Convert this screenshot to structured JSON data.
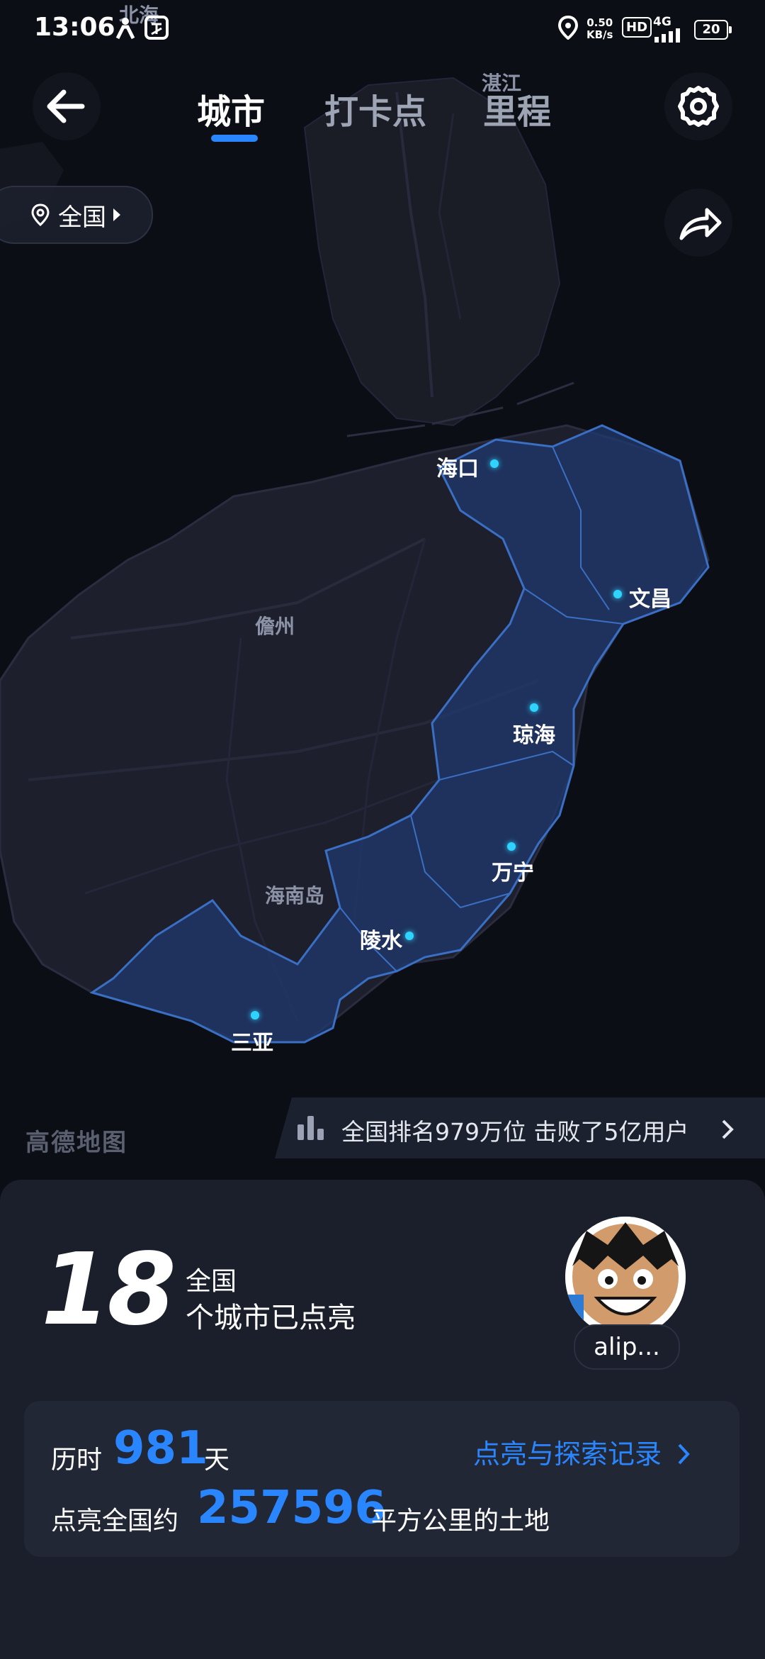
{
  "status_bar": {
    "time": "13:06",
    "net_speed_value": "0.50",
    "net_speed_unit": "KB/s",
    "hd_label": "HD",
    "signal_label": "4G",
    "battery_level": "20",
    "icons": [
      "person-icon",
      "app-badge-icon",
      "location-icon",
      "hd-icon",
      "signal-icon",
      "battery-icon"
    ]
  },
  "nav": {
    "tabs": [
      {
        "label": "城市",
        "active": true
      },
      {
        "label": "打卡点",
        "active": false
      },
      {
        "label": "里程",
        "active": false
      }
    ],
    "back_icon": "arrow-left-icon",
    "settings_icon": "gear-icon",
    "share_icon": "share-icon"
  },
  "region_selector": {
    "label": "全国"
  },
  "map": {
    "geo_labels": [
      "北海",
      "湛江",
      "儋州",
      "海南岛"
    ],
    "cities": [
      "海口",
      "文昌",
      "琼海",
      "万宁",
      "陵水",
      "三亚"
    ],
    "highlight_color": "#1f3a6e",
    "dot_color": "#2fd3ff",
    "logo": "高德地图"
  },
  "rank_banner": {
    "text": "全国排名979万位 击败了5亿用户"
  },
  "summary": {
    "city_count": "18",
    "scope": "全国",
    "count_suffix": "个城市已点亮",
    "username": "alip..."
  },
  "stats": {
    "days_prefix": "历时",
    "days_value": "981",
    "days_unit": "天",
    "records_link": "点亮与探索记录",
    "area_prefix": "点亮全国约",
    "area_value": "257596",
    "area_unit": "平方公里的土地"
  },
  "accent_color": "#2a86ff"
}
